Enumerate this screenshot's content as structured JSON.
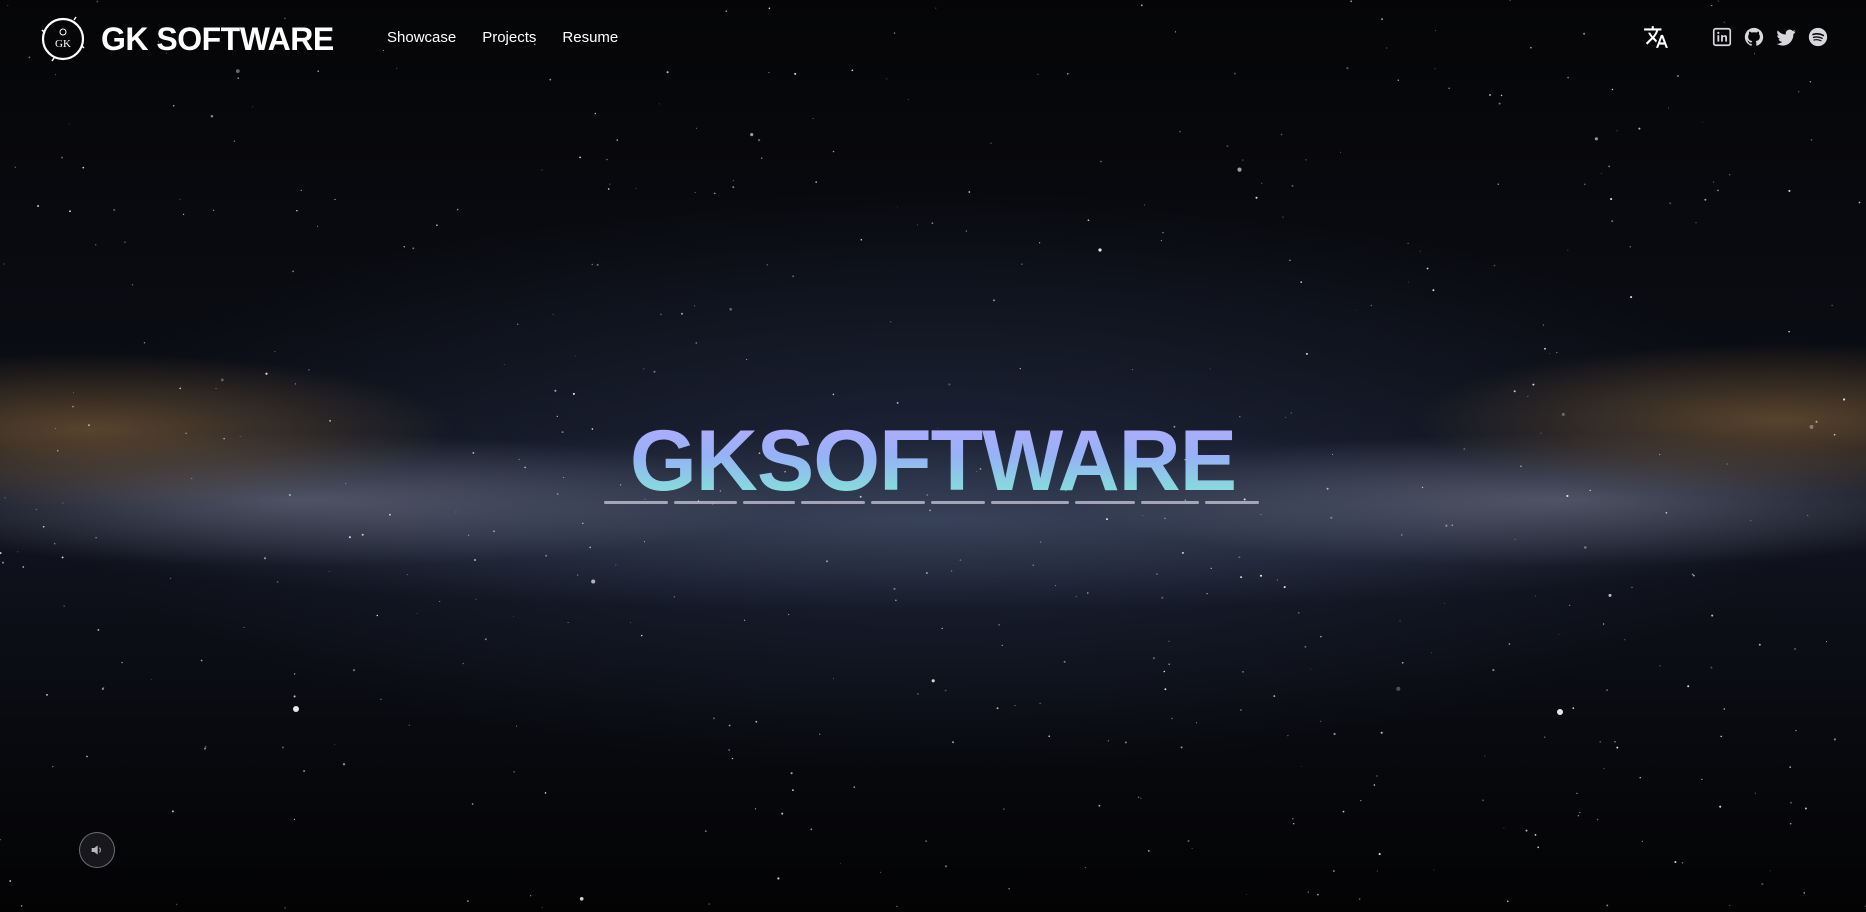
{
  "header": {
    "logo_text": "GK SOFTWARE",
    "logo_mark_letters": "GK",
    "nav": [
      {
        "label": "Showcase"
      },
      {
        "label": "Projects"
      },
      {
        "label": "Resume"
      }
    ],
    "icons": {
      "translate": "translate-icon",
      "social": [
        "linkedin-icon",
        "github-icon",
        "twitter-icon",
        "spotify-icon"
      ]
    }
  },
  "hero": {
    "title": "GKSOFTWARE",
    "gradient": [
      "#b7a9ff",
      "#96b2f6",
      "#7ff0d0"
    ]
  },
  "controls": {
    "sound_icon": "speaker-icon"
  },
  "colors": {
    "text": "#ffffff",
    "background": "#050507"
  }
}
